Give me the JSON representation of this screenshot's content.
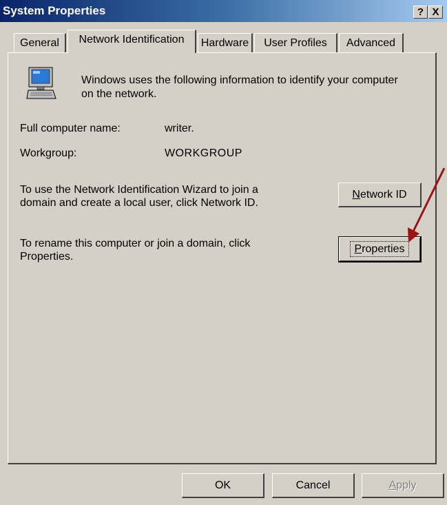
{
  "window": {
    "title": "System Properties",
    "help_glyph": "?",
    "close_glyph": "X"
  },
  "tabs": [
    {
      "label": "General",
      "selected": false
    },
    {
      "label": "Network Identification",
      "selected": true
    },
    {
      "label": "Hardware",
      "selected": false
    },
    {
      "label": "User Profiles",
      "selected": false
    },
    {
      "label": "Advanced",
      "selected": false
    }
  ],
  "panel": {
    "intro_line1": "Windows uses the following information to identify your computer",
    "intro_line2": "on the network.",
    "full_name_label": "Full computer name:",
    "full_name_value": "writer.",
    "workgroup_label": "Workgroup:",
    "workgroup_value": "WORKGROUP",
    "wizard_line1": "To use the Network Identification Wizard to join a",
    "wizard_line2": "domain and create a local user, click Network ID.",
    "network_id_accel": "N",
    "network_id_rest": "etwork ID",
    "rename_line1": "To rename this computer or join a domain, click",
    "rename_line2": "Properties.",
    "properties_accel": "P",
    "properties_rest": "roperties"
  },
  "footer": {
    "ok_label": "OK",
    "cancel_label": "Cancel",
    "apply_accel": "A",
    "apply_rest": "pply"
  },
  "annotation": {
    "arrow_color": "#9b1414"
  },
  "icons": [
    "computer-icon",
    "help-icon",
    "close-icon",
    "arrow-annotation"
  ]
}
